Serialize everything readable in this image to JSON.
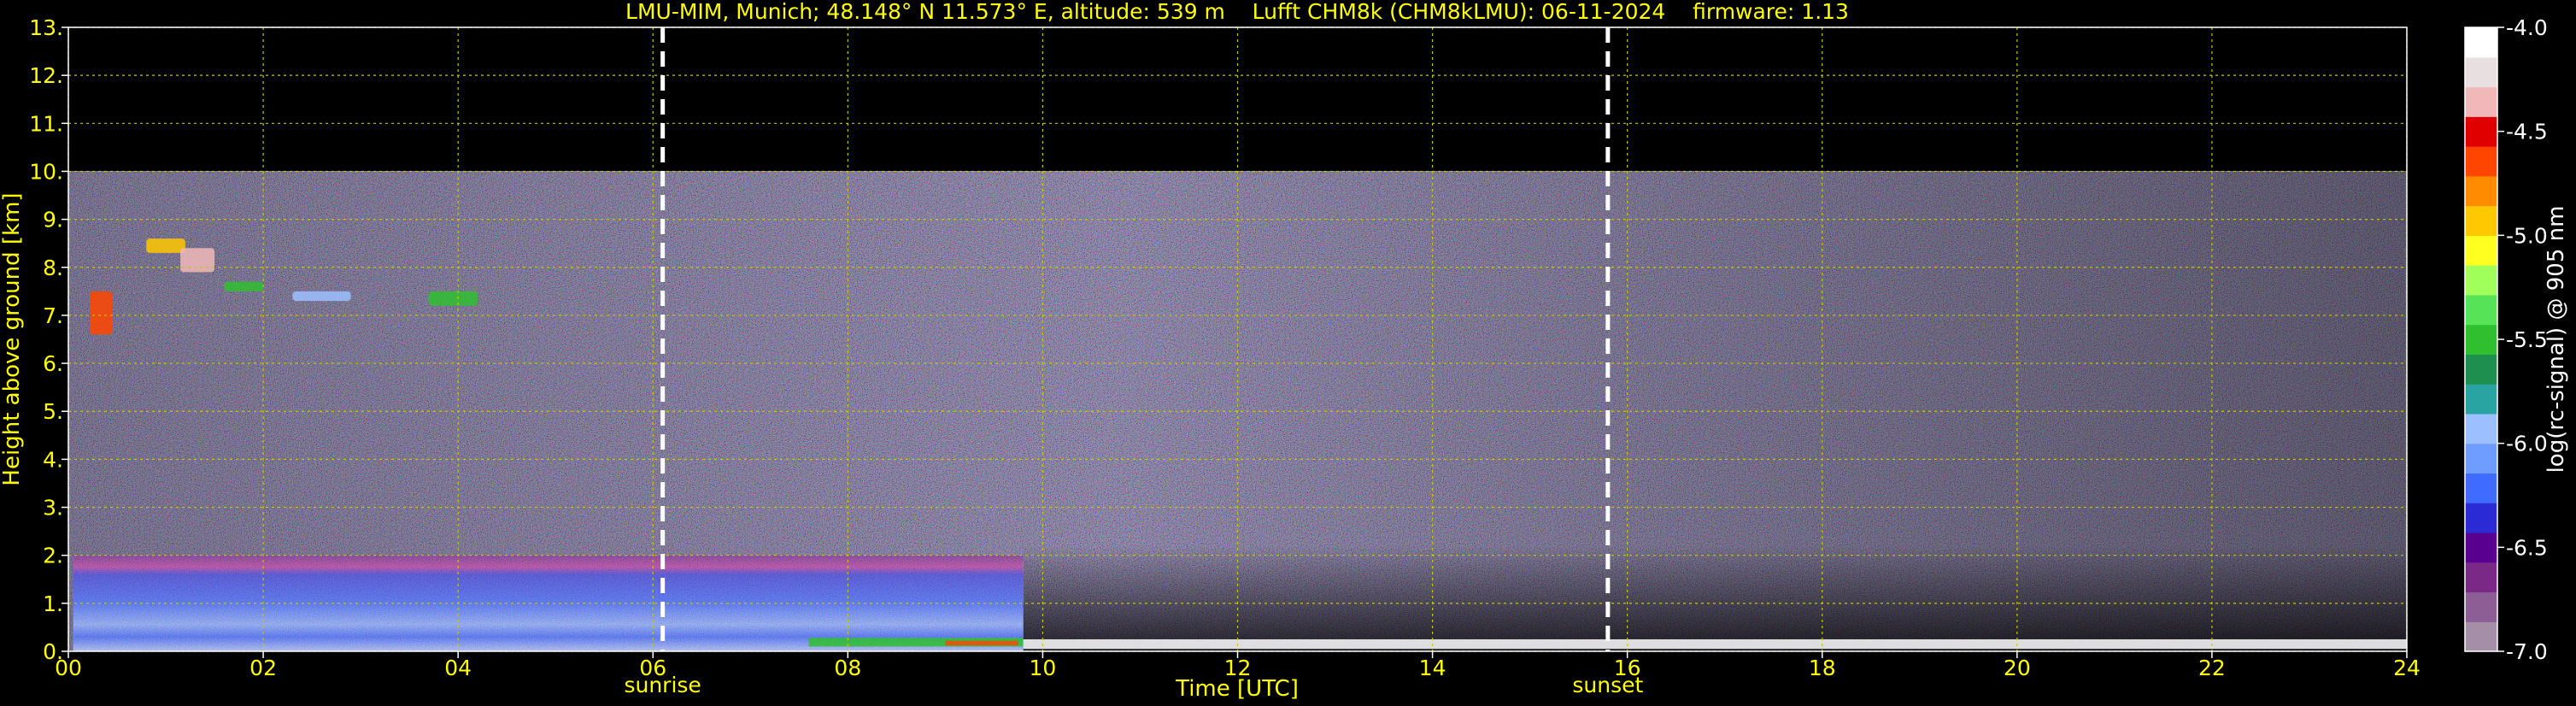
{
  "chart_data": {
    "type": "heatmap",
    "title": "LMU-MIM, Munich; 48.148° N 11.573° E, altitude: 539 m    Lufft CHM8k (CHM8kLMU): 06-11-2024    firmware: 1.13",
    "xlabel": "Time [UTC]",
    "ylabel": "Height above ground [km]",
    "xlim": [
      0,
      24
    ],
    "ylim": [
      0,
      13
    ],
    "x_ticks": [
      0,
      2,
      4,
      6,
      8,
      10,
      12,
      14,
      16,
      18,
      20,
      22,
      24
    ],
    "x_tick_labels": [
      "00",
      "02",
      "04",
      "06",
      "08",
      "10",
      "12",
      "14",
      "16",
      "18",
      "20",
      "22",
      "24"
    ],
    "y_ticks": [
      0,
      1,
      2,
      3,
      4,
      5,
      6,
      7,
      8,
      9,
      10,
      11,
      12,
      13
    ],
    "y_tick_labels": [
      "0.",
      "1.",
      "2.",
      "3.",
      "4.",
      "5.",
      "6.",
      "7.",
      "8.",
      "9.",
      "10.",
      "11.",
      "12.",
      "13."
    ],
    "grid": true,
    "events": [
      {
        "label": "sunrise",
        "x": 6.1
      },
      {
        "label": "sunset",
        "x": 15.8
      }
    ],
    "colorbar": {
      "label": "log(rc-signal) @ 905 nm",
      "range": [
        -7.0,
        -4.0
      ],
      "ticks": [
        -4.0,
        -4.5,
        -5.0,
        -5.5,
        -6.0,
        -6.5,
        -7.0
      ],
      "tick_labels": [
        "-4.0",
        "-4.5",
        "-5.0",
        "-5.5",
        "-6.0",
        "-6.5",
        "-7.0"
      ],
      "colors": [
        "#a48ea8",
        "#8d5e96",
        "#7a2a86",
        "#5a0090",
        "#2b2bd6",
        "#3f6bff",
        "#6f9cff",
        "#9cc0ff",
        "#2aa3a3",
        "#1f8f4f",
        "#2fbf2f",
        "#57e357",
        "#a0ff5a",
        "#ffff20",
        "#ffc800",
        "#ff8c00",
        "#ff4500",
        "#e00000",
        "#f0b8b8",
        "#e8e0e0",
        "#ffffff"
      ]
    },
    "signal_regions": {
      "data_top_km": 10.0,
      "boundary_layer_km": [
        0.0,
        2.0
      ],
      "boundary_layer_end_hour": 9.8,
      "surface_layer_km": [
        0.05,
        0.25
      ],
      "cirrus_clouds_km": [
        7.0,
        8.5
      ],
      "cirrus_hours": [
        0.2,
        4.5
      ]
    }
  }
}
